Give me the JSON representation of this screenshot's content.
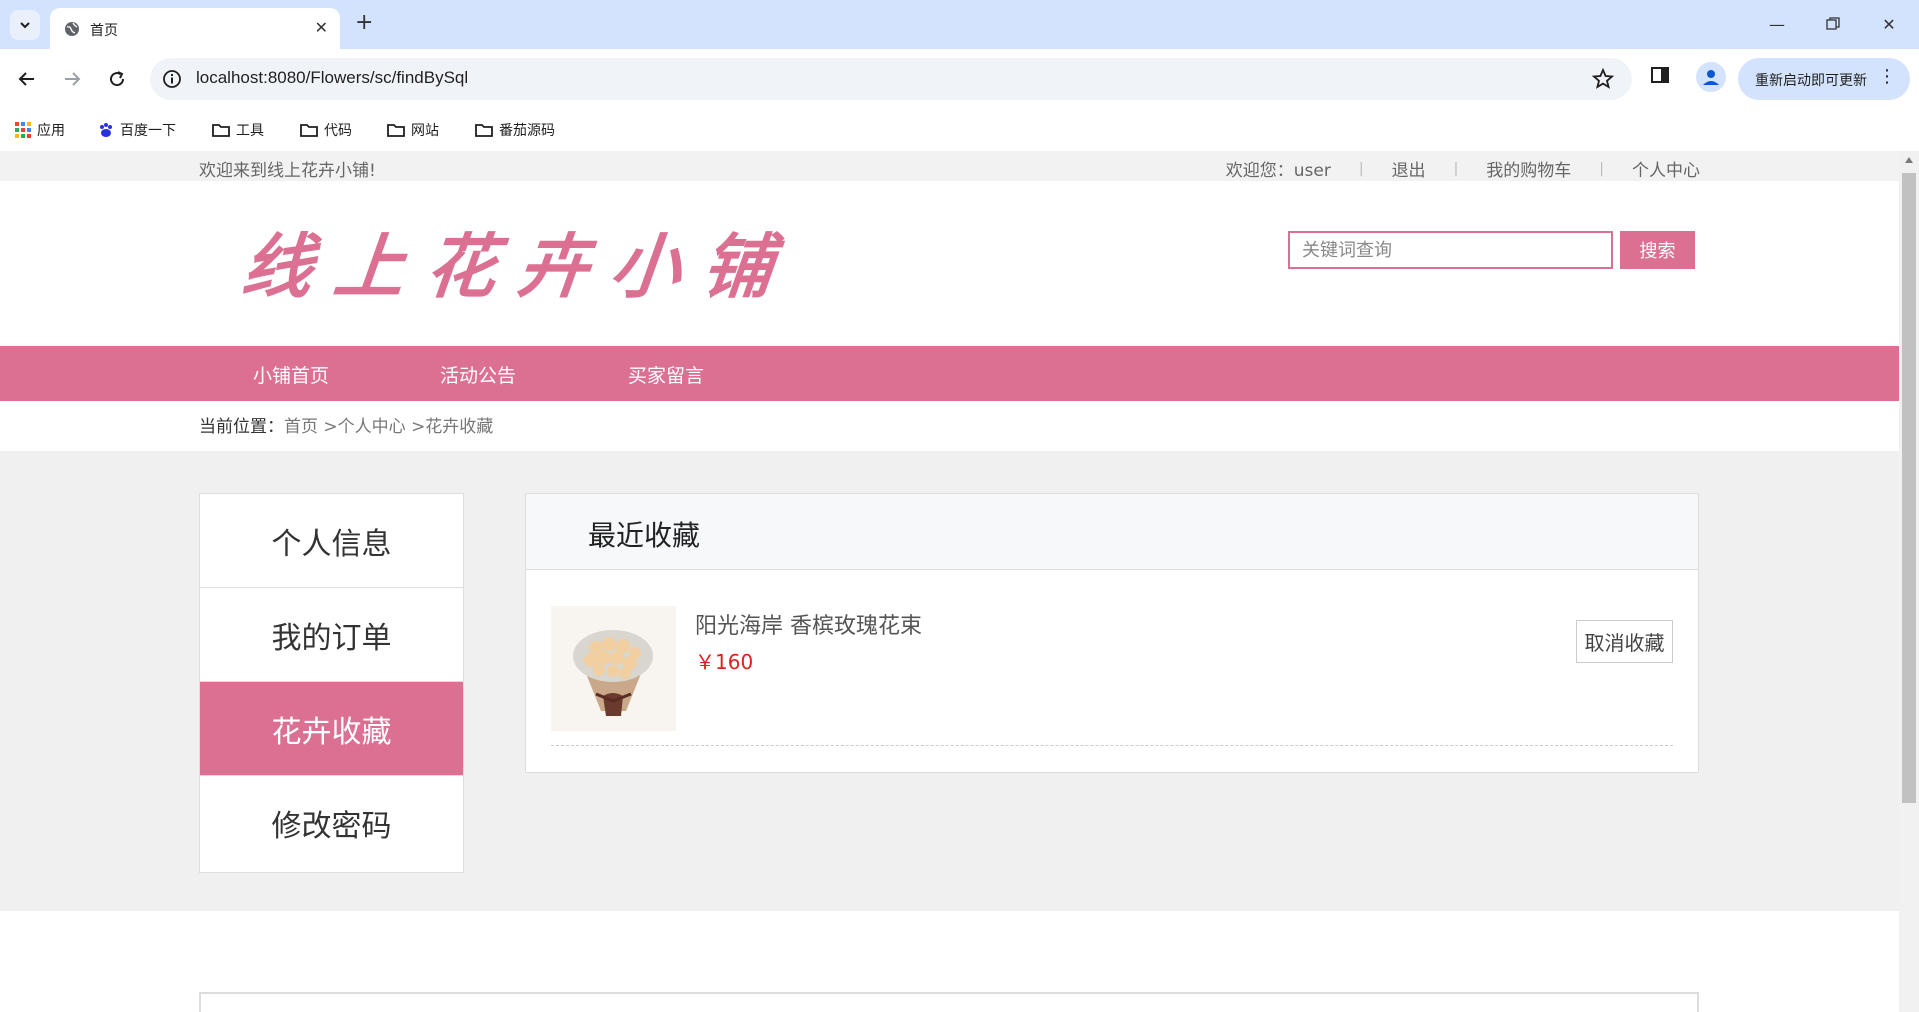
{
  "browser": {
    "tab_title": "首页",
    "url": "localhost:8080/Flowers/sc/findBySql",
    "update_button": "重新启动即可更新",
    "bookmarks": [
      "应用",
      "百度一下",
      "工具",
      "代码",
      "网站",
      "番茄源码"
    ]
  },
  "site": {
    "welcome": "欢迎来到线上花卉小铺!",
    "user_greeting": "欢迎您：user",
    "logout": "退出",
    "cart": "我的购物车",
    "profile": "个人中心",
    "logo": "线上花卉小铺",
    "search_placeholder": "关键词查询",
    "search_button": "搜索",
    "nav": [
      "小铺首页",
      "活动公告",
      "买家留言"
    ],
    "breadcrumb": {
      "label": "当前位置：",
      "home": "首页",
      "center": ">个人中心",
      "current": ">花卉收藏"
    }
  },
  "sidebar": [
    "个人信息",
    "我的订单",
    "花卉收藏",
    "修改密码"
  ],
  "panel": {
    "title": "最近收藏",
    "item": {
      "name": "阳光海岸 香槟玫瑰花束",
      "price": "￥160",
      "cancel": "取消收藏"
    }
  },
  "colors": {
    "brand": "#db7093",
    "price": "#e02020",
    "chrome": "#d3e3fd"
  }
}
